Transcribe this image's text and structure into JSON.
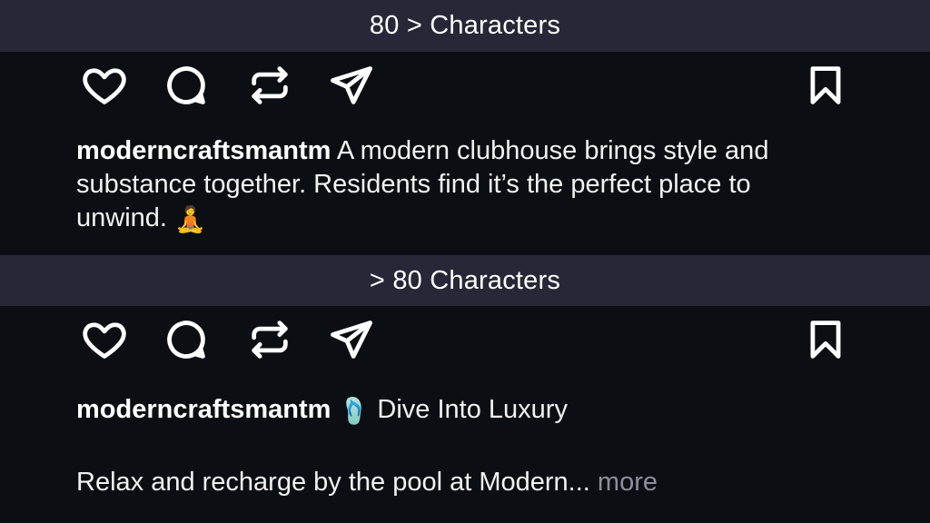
{
  "sections": [
    {
      "banner": "80 > Characters",
      "post": {
        "username": "moderncraftsmantm",
        "caption": "A modern clubhouse brings style and substance together. Residents find it’s the perfect place to unwind.",
        "emoji": "🧘",
        "emoji_name": "person-in-lotus-position"
      }
    },
    {
      "banner": "> 80 Characters",
      "post": {
        "username": "moderncraftsmantm",
        "emoji": "🩴",
        "emoji_name": "pool-slide-emoji",
        "caption_title": "Dive Into Luxury",
        "caption_preview": "Relax and recharge by the pool at Modern...",
        "more_label": "more"
      }
    }
  ],
  "icons": {
    "like": "heart-icon",
    "comment": "comment-icon",
    "repost": "repost-icon",
    "share": "send-icon",
    "save": "bookmark-icon"
  },
  "colors": {
    "background": "#0b0f14",
    "banner": "#262838",
    "text": "#ffffff",
    "muted": "#8b8f9c"
  }
}
